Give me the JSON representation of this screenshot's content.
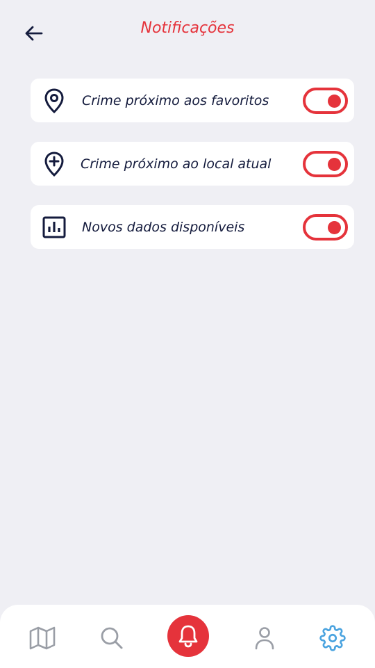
{
  "header": {
    "title": "Notificações",
    "back_icon": "arrow-left-icon"
  },
  "notifications": [
    {
      "label": "Crime próximo aos favoritos",
      "icon": "map-pin-icon",
      "enabled": true
    },
    {
      "label": "Crime próximo ao local atual",
      "icon": "map-pin-plus-icon",
      "enabled": true
    },
    {
      "label": "Novos dados disponíveis",
      "icon": "bar-chart-icon",
      "enabled": true
    }
  ],
  "bottom_nav": {
    "items": [
      "map-icon",
      "search-icon",
      "bell-icon",
      "user-icon",
      "settings-icon"
    ],
    "active": "bell-icon"
  },
  "colors": {
    "accent": "#e5333b",
    "text": "#141b3d",
    "background": "#efeff4",
    "inactive_icon": "#9a9ea6",
    "settings_icon": "#4aa3df"
  }
}
